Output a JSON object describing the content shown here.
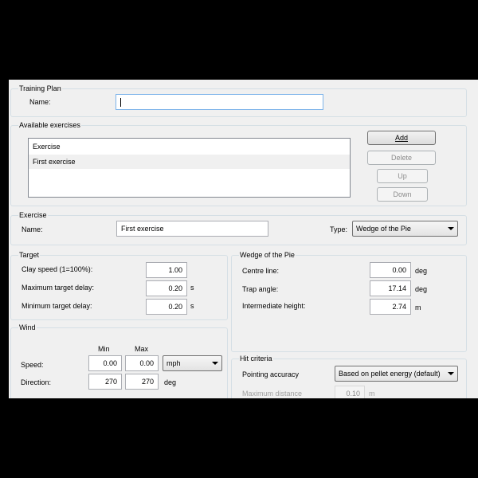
{
  "training_plan": {
    "title": "Training Plan",
    "name_label": "Name:",
    "name_value": ""
  },
  "available_exercises": {
    "title": "Available exercises",
    "column_header": "Exercise",
    "items": [
      "First exercise"
    ],
    "buttons": {
      "add": "Add",
      "delete": "Delete",
      "up": "Up",
      "down": "Down"
    }
  },
  "exercise": {
    "title": "Exercise",
    "name_label": "Name:",
    "name_value": "First exercise",
    "type_label": "Type:",
    "type_value": "Wedge of the Pie"
  },
  "target": {
    "title": "Target",
    "rows": [
      {
        "label": "Clay speed (1=100%):",
        "value": "1.00",
        "unit": ""
      },
      {
        "label": "Maximum target delay:",
        "value": "0.20",
        "unit": "s"
      },
      {
        "label": "Minimum target delay:",
        "value": "0.20",
        "unit": "s"
      }
    ]
  },
  "wedge": {
    "title": "Wedge of the Pie",
    "rows": [
      {
        "label": "Centre line:",
        "value": "0.00",
        "unit": "deg"
      },
      {
        "label": "Trap angle:",
        "value": "17.14",
        "unit": "deg"
      },
      {
        "label": "Intermediate height:",
        "value": "2.74",
        "unit": "m"
      }
    ]
  },
  "wind": {
    "title": "Wind",
    "min_header": "Min",
    "max_header": "Max",
    "speed_label": "Speed:",
    "speed_min": "0.00",
    "speed_max": "0.00",
    "speed_unit": "mph",
    "direction_label": "Direction:",
    "direction_min": "270",
    "direction_max": "270",
    "direction_unit": "deg"
  },
  "hit_criteria": {
    "title": "Hit criteria",
    "pointing_label": "Pointing accuracy",
    "pointing_value": "Based on pellet energy (default)",
    "max_distance_label": "Maximum distance",
    "max_distance_value": "0.10",
    "max_distance_unit": "m"
  }
}
